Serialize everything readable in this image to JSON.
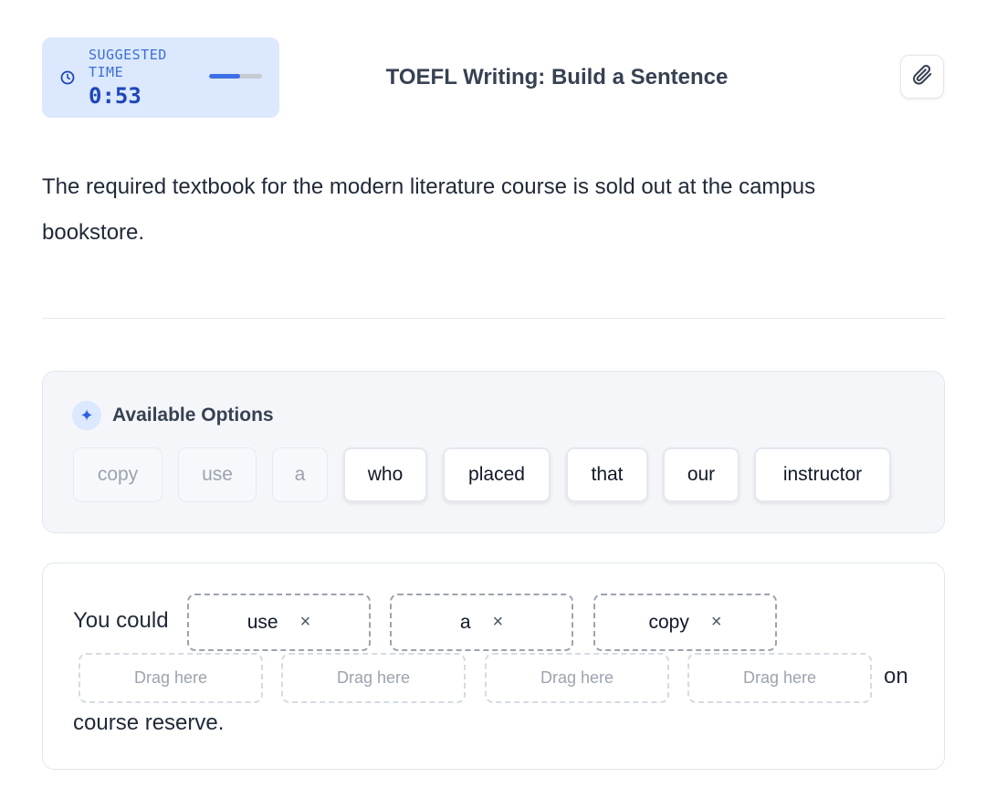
{
  "timer": {
    "label": "SUGGESTED TIME",
    "value": "0:53",
    "progress_percent": 58,
    "icon": "clock-icon"
  },
  "header": {
    "title": "TOEFL Writing: Build a Sentence",
    "attach_icon": "paperclip-icon"
  },
  "prompt": {
    "text": "The required textbook for the modern literature course is sold out at the campus bookstore."
  },
  "options": {
    "title": "Available Options",
    "icon": "sparkle-icon",
    "chips": [
      {
        "label": "copy",
        "state": "used"
      },
      {
        "label": "use",
        "state": "used"
      },
      {
        "label": "a",
        "state": "used"
      },
      {
        "label": "who",
        "state": "available"
      },
      {
        "label": "placed",
        "state": "available"
      },
      {
        "label": "that",
        "state": "available"
      },
      {
        "label": "our",
        "state": "available"
      },
      {
        "label": "instructor",
        "state": "available"
      }
    ]
  },
  "answer": {
    "prefix": "You could",
    "filled_slots": [
      {
        "word": "use",
        "remove_glyph": "×"
      },
      {
        "word": "a",
        "remove_glyph": "×"
      },
      {
        "word": "copy",
        "remove_glyph": "×"
      }
    ],
    "empty_slots": [
      {
        "placeholder": "Drag here"
      },
      {
        "placeholder": "Drag here"
      },
      {
        "placeholder": "Drag here"
      },
      {
        "placeholder": "Drag here"
      }
    ],
    "middle": "on",
    "suffix": "course reserve."
  },
  "colors": {
    "timer_bg": "#dbe8fd",
    "accent": "#3d6fe6",
    "panel_bg": "#f4f6fa"
  }
}
